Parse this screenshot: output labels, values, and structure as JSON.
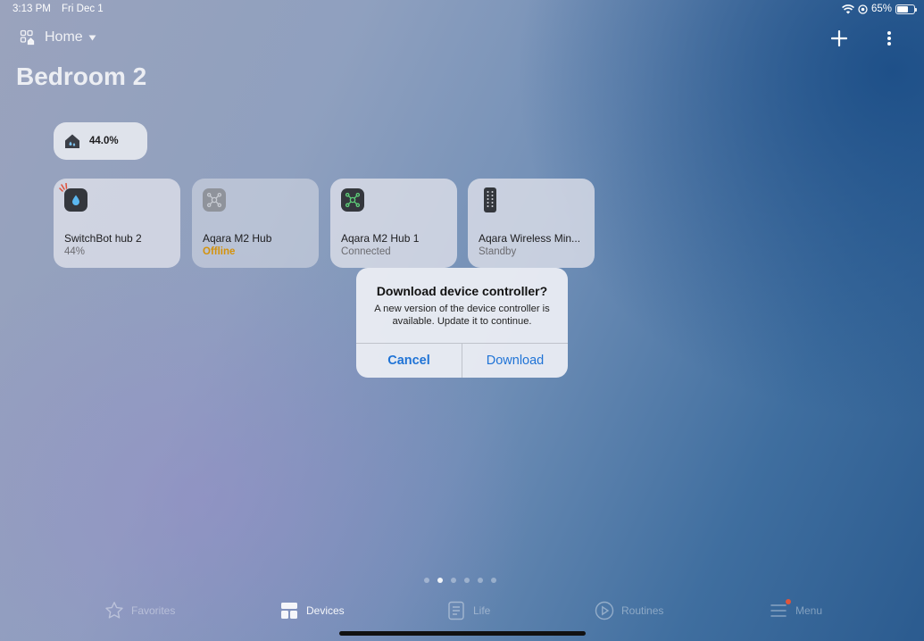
{
  "status_bar": {
    "time": "3:13 PM",
    "date": "Fri Dec 1",
    "battery_percent": "65%",
    "battery_level": 0.65,
    "icons": [
      "wifi-icon",
      "location-lock-icon",
      "battery-icon"
    ]
  },
  "header": {
    "home_label": "Home",
    "home_icon": "home-grid-icon",
    "dropdown_icon": "caret-down-icon",
    "add_icon": "plus-icon",
    "more_icon": "more-vertical-icon"
  },
  "page": {
    "title": "Bedroom 2"
  },
  "sensor": {
    "value": "44.0%",
    "icon": "home-humidity-icon"
  },
  "devices": [
    {
      "name": "SwitchBot hub 2",
      "status": "44%",
      "icon": "water-drop-icon"
    },
    {
      "name": "Aqara M2 Hub",
      "status": "Offline",
      "icon": "hub-icon"
    },
    {
      "name": "Aqara M2 Hub 1",
      "status": "Connected",
      "icon": "hub-icon"
    },
    {
      "name": "Aqara Wireless Min...",
      "status": "Standby",
      "icon": "remote-icon"
    }
  ],
  "dialog": {
    "title": "Download device controller?",
    "message": "A new version of the device controller is available. Update it to continue.",
    "cancel_label": "Cancel",
    "download_label": "Download",
    "accent": "#1f73d6"
  },
  "pagination": {
    "count": 6,
    "active_index": 1
  },
  "tabs": [
    {
      "label": "Favorites",
      "icon": "star-icon",
      "active": false
    },
    {
      "label": "Devices",
      "icon": "devices-grid-icon",
      "active": true
    },
    {
      "label": "Life",
      "icon": "life-doc-icon",
      "active": false
    },
    {
      "label": "Routines",
      "icon": "play-circle-icon",
      "active": false
    },
    {
      "label": "Menu",
      "icon": "menu-icon",
      "active": false
    }
  ],
  "colors": {
    "offline": "#d4920c",
    "badge": "#e0553a"
  }
}
